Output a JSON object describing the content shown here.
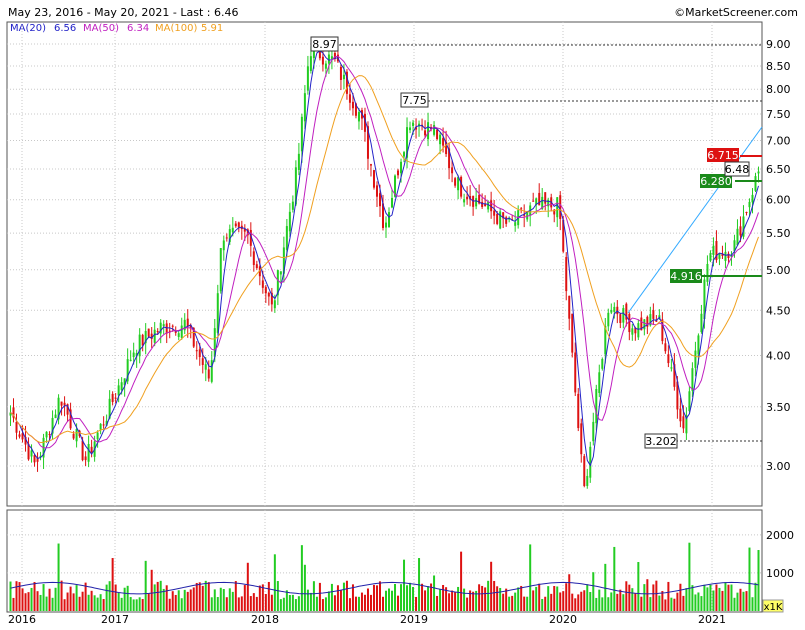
{
  "header": {
    "range_text": "May 23, 2016 - May 20, 2021 - Last : 6.46",
    "copyright": "©MarketScreener.com"
  },
  "legend": [
    {
      "label": "MA(20)",
      "value": "6.56",
      "color": "#2323c8"
    },
    {
      "label": "MA(50)",
      "value": "6.34",
      "color": "#c020c0"
    },
    {
      "label": "MA(100)",
      "value": "5.91",
      "color": "#f0a020"
    }
  ],
  "colors": {
    "up": "#22cc22",
    "down": "#dd1111",
    "grid": "#c8c8c8",
    "trendline": "#33aaff",
    "volume_ma": "#2222aa",
    "support_label": "#1a8a1a",
    "resistance_label": "#dd1111"
  },
  "annotations": {
    "high_2018": "8.97",
    "high_2019": "7.75",
    "low_2021": "3.202",
    "last_box": "6.48",
    "resistance": "6.715",
    "support_near": "6.280",
    "support_far": "4.916"
  },
  "volume_unit": "x1K",
  "chart_data": {
    "type": "candlestick",
    "price_axis": {
      "ticks": [
        3.0,
        3.5,
        4.0,
        4.5,
        5.0,
        5.5,
        6.0,
        6.5,
        7.0,
        7.5,
        8.0,
        8.5,
        9.0
      ],
      "ylim": [
        2.6,
        9.3
      ],
      "scale": "log"
    },
    "volume_axis": {
      "ticks": [
        1000,
        2000
      ],
      "ylim": [
        0,
        2600
      ]
    },
    "x_ticks": [
      "2016",
      "2017",
      "2018",
      "2019",
      "2020",
      "2021"
    ],
    "price_path": [
      [
        "2016-05",
        3.45
      ],
      [
        "2016-07",
        3.0
      ],
      [
        "2016-09",
        3.6
      ],
      [
        "2016-11",
        3.05
      ],
      [
        "2017-01",
        3.5
      ],
      [
        "2017-03",
        4.1
      ],
      [
        "2017-05",
        4.3
      ],
      [
        "2017-07",
        4.35
      ],
      [
        "2017-09",
        3.75
      ],
      [
        "2017-10",
        5.5
      ],
      [
        "2017-12",
        5.45
      ],
      [
        "2018-02",
        4.5
      ],
      [
        "2018-04",
        6.5
      ],
      [
        "2018-05",
        8.9
      ],
      [
        "2018-07",
        8.6
      ],
      [
        "2018-09",
        7.5
      ],
      [
        "2018-11",
        5.6
      ],
      [
        "2019-01",
        7.4
      ],
      [
        "2019-03",
        7.2
      ],
      [
        "2019-05",
        6.2
      ],
      [
        "2019-07",
        5.9
      ],
      [
        "2019-09",
        5.6
      ],
      [
        "2019-11",
        5.9
      ],
      [
        "2020-01",
        5.9
      ],
      [
        "2020-03",
        2.8
      ],
      [
        "2020-05",
        4.6
      ],
      [
        "2020-07",
        4.3
      ],
      [
        "2020-09",
        4.4
      ],
      [
        "2020-11",
        3.3
      ],
      [
        "2021-01",
        5.2
      ],
      [
        "2021-03",
        5.3
      ],
      [
        "2021-05",
        6.46
      ]
    ]
  }
}
